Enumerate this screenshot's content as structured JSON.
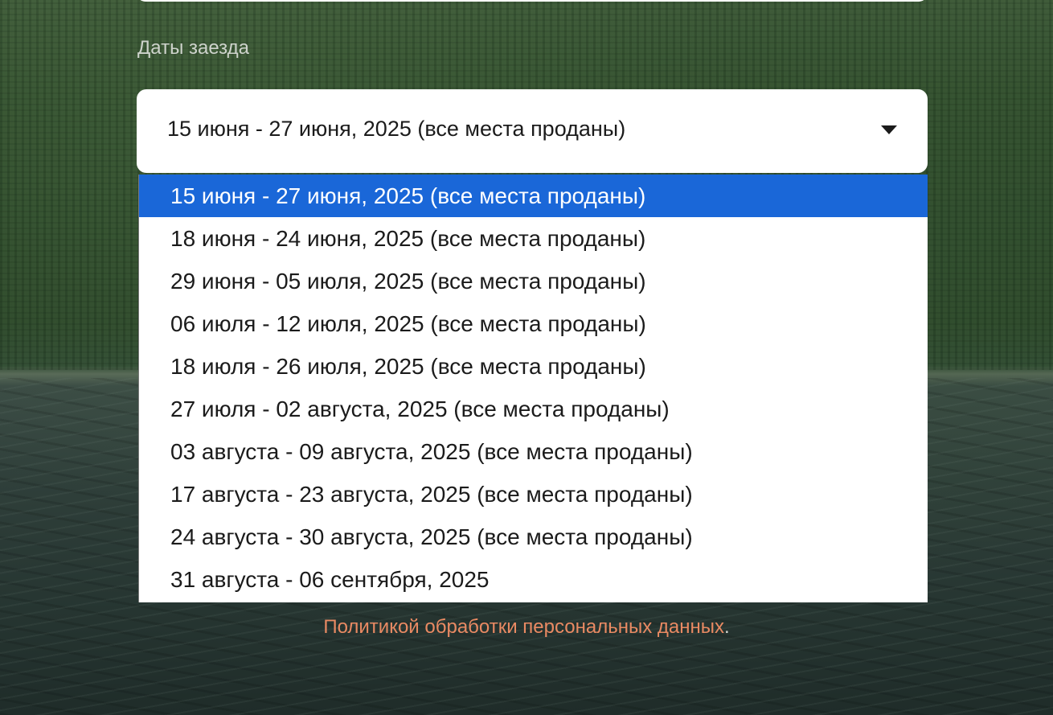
{
  "form": {
    "dates_label": "Даты заезда",
    "selected_value": "15 июня - 27 июня, 2025 (все места проданы)",
    "options": [
      "15 июня - 27 июня, 2025 (все места проданы)",
      "18 июня - 24 июня, 2025 (все места проданы)",
      "29 июня - 05 июля, 2025 (все места проданы)",
      "06 июля - 12 июля, 2025 (все места проданы)",
      "18 июля - 26 июля, 2025 (все места проданы)",
      "27 июля - 02 августа, 2025 (все места проданы)",
      "03 августа - 09 августа, 2025 (все места проданы)",
      "17 августа - 23 августа, 2025 (все места проданы)",
      "24 августа - 30 августа, 2025 (все места проданы)",
      "31 августа - 06 сентября, 2025"
    ],
    "highlight_index": 0
  },
  "footer": {
    "policy_link": "Политикой обработки персональных данных",
    "trailing": "."
  },
  "colors": {
    "highlight": "#1a67d8",
    "link": "#e98a63"
  },
  "icons": {
    "dropdown": "chevron-down-icon"
  }
}
